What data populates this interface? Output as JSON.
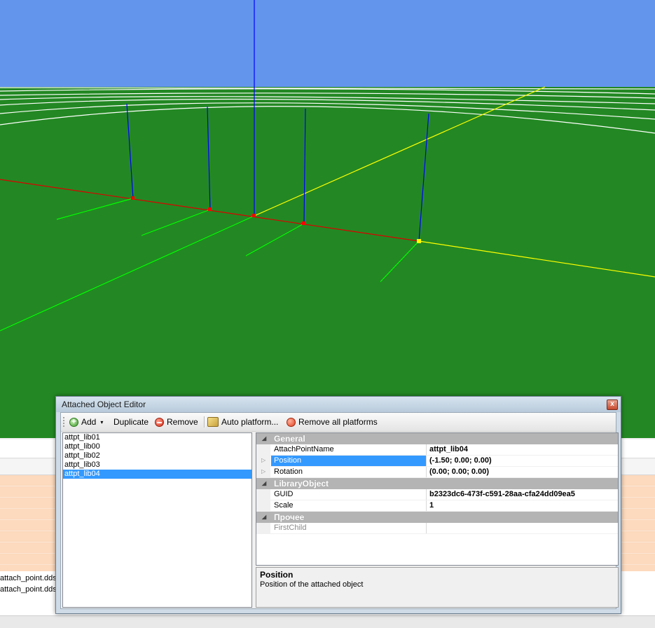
{
  "window": {
    "title": "Attached Object Editor",
    "close_glyph": "x"
  },
  "toolbar": {
    "add_label": "Add",
    "dropdown_glyph": "▾",
    "duplicate_label": "Duplicate",
    "remove_label": "Remove",
    "auto_platform_label": "Auto platform...",
    "remove_all_platforms_label": "Remove all platforms"
  },
  "list": {
    "items": [
      "attpt_lib01",
      "attpt_lib00",
      "attpt_lib02",
      "attpt_lib03",
      "attpt_lib04"
    ],
    "selected": "attpt_lib04"
  },
  "property_grid": {
    "toggle_glyph": "◢",
    "expander_glyph": "▷",
    "categories": [
      {
        "label": "General",
        "rows": [
          {
            "name": "AttachPointName",
            "value": "attpt_lib04"
          },
          {
            "name": "Position",
            "value": "(-1.50; 0.00; 0.00)"
          },
          {
            "name": "Rotation",
            "value": "(0.00; 0.00; 0.00)"
          }
        ]
      },
      {
        "label": "LibraryObject",
        "rows": [
          {
            "name": "GUID",
            "value": "b2323dc6-473f-c591-28aa-cfa24dd09ea5"
          },
          {
            "name": "Scale",
            "value": "1"
          }
        ]
      },
      {
        "label": "Прочее",
        "rows": [
          {
            "name": "FirstChild",
            "value": ""
          }
        ]
      }
    ]
  },
  "help": {
    "title": "Position",
    "description": "Position of the attached object"
  },
  "background_files": [
    "attach_point.dds",
    "attach_point.dds"
  ],
  "colors": {
    "sky": "#6495ed",
    "ground": "#238823",
    "selection": "#3399ff",
    "highlight_row": "#fdd9bd"
  }
}
